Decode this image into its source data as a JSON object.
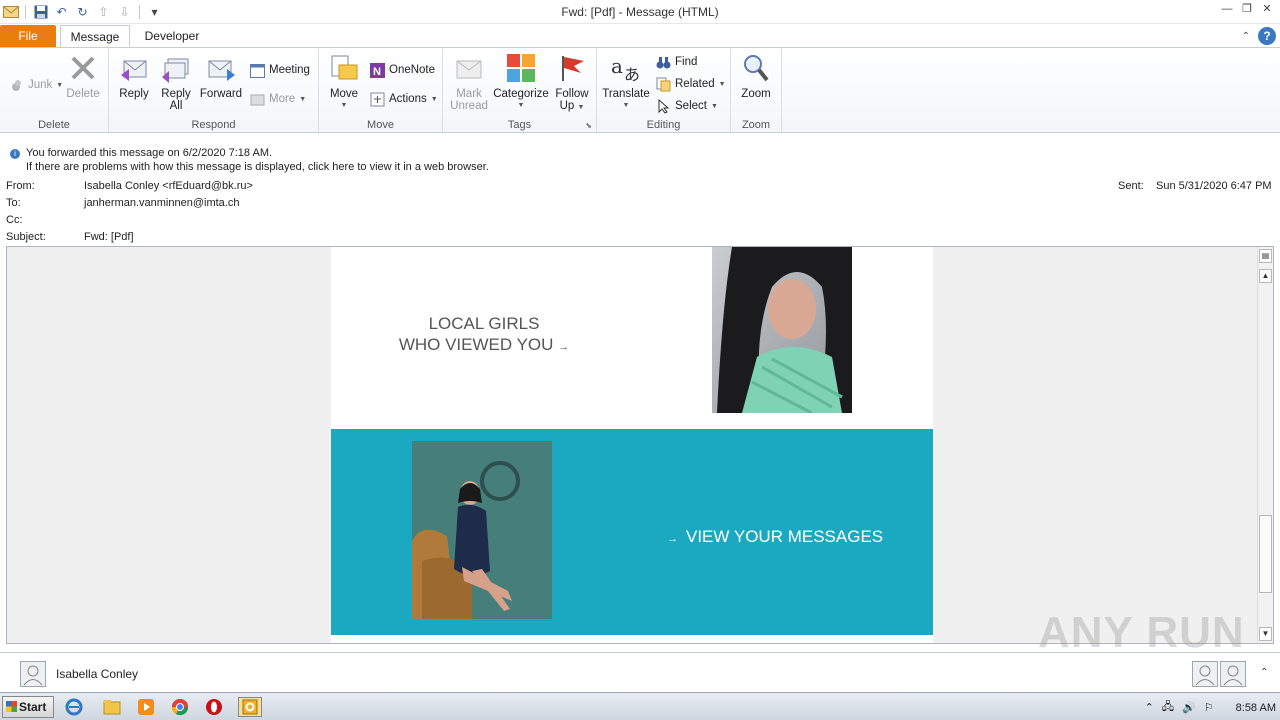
{
  "window": {
    "title": "Fwd: [Pdf]    - Message (HTML)"
  },
  "tabs": [
    {
      "label": "File"
    },
    {
      "label": "Message"
    },
    {
      "label": "Developer"
    }
  ],
  "ribbon": {
    "delete_group": {
      "label": "Delete",
      "junk": "Junk",
      "delete": "Delete"
    },
    "respond_group": {
      "label": "Respond",
      "reply": "Reply",
      "reply_all_1": "Reply",
      "reply_all_2": "All",
      "forward": "Forward",
      "meeting": "Meeting",
      "more": "More"
    },
    "move_group": {
      "label": "Move",
      "move": "Move",
      "onenote": "OneNote",
      "actions": "Actions"
    },
    "tags_group": {
      "label": "Tags",
      "mark_unread_1": "Mark",
      "mark_unread_2": "Unread",
      "categorize": "Categorize",
      "follow_up_1": "Follow",
      "follow_up_2": "Up"
    },
    "editing_group": {
      "label": "Editing",
      "translate": "Translate",
      "find": "Find",
      "related": "Related",
      "select": "Select"
    },
    "zoom_group": {
      "label": "Zoom",
      "zoom": "Zoom"
    }
  },
  "info": {
    "forwarded": "You forwarded this message on 6/2/2020 7:18 AM.",
    "problems": "If there are problems with how this message is displayed, click here to view it in a web browser."
  },
  "header": {
    "from_label": "From:",
    "from_value": "Isabella Conley <rfEduard@bk.ru>",
    "to_label": "To:",
    "to_value": "janherman.vanminnen@imta.ch",
    "cc_label": "Cc:",
    "subject_label": "Subject:",
    "subject_value": "Fwd: [Pdf]",
    "sent_label": "Sent:",
    "sent_value": "Sun 5/31/2020 6:47 PM"
  },
  "email_body": {
    "local_line1": "LOCAL GIRLS",
    "local_line2": "WHO VIEWED YOU",
    "arrow": "→",
    "view_messages": "VIEW YOUR MESSAGES",
    "teal_color": "#1aa9c1"
  },
  "people_pane": {
    "name": "Isabella Conley"
  },
  "watermark": "ANY RUN",
  "taskbar": {
    "start": "Start",
    "clock": "8:58 AM"
  }
}
